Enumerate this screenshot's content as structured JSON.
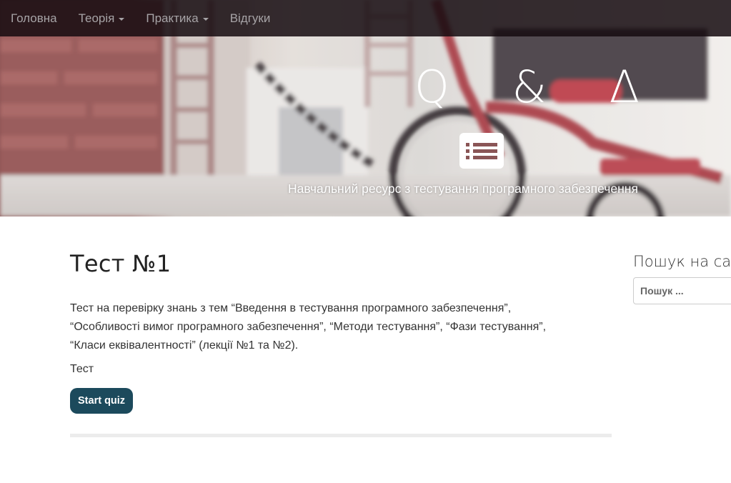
{
  "navbar": {
    "items": [
      {
        "label": "Головна",
        "dropdown": false
      },
      {
        "label": "Теорія",
        "dropdown": true
      },
      {
        "label": "Практика",
        "dropdown": true
      },
      {
        "label": "Відгуки",
        "dropdown": false
      }
    ]
  },
  "hero": {
    "logo": "Q & Δ",
    "icon": "list-icon",
    "tagline": "Навчальний ресурс з тестування програмного забезпечення"
  },
  "post": {
    "title": "Тест №1",
    "body": "Тест на перевірку знань з тем “Введення в тестування програмного забезпечення”, “Особливості вимог програмного забезпечення”, “Методи тестування”, “Фази тестування”, “Класи еквівалентності” (лекції №1 та №2).",
    "sub": "Тест",
    "button_label": "Start quiz"
  },
  "sidebar": {
    "title": "Пошук на сайті",
    "search_placeholder": "Пошук ..."
  },
  "colors": {
    "navbar_bg": "#160c10",
    "nav_text": "#a6a3a6",
    "button_bg": "#1c4a5c",
    "divider": "#ececec"
  }
}
